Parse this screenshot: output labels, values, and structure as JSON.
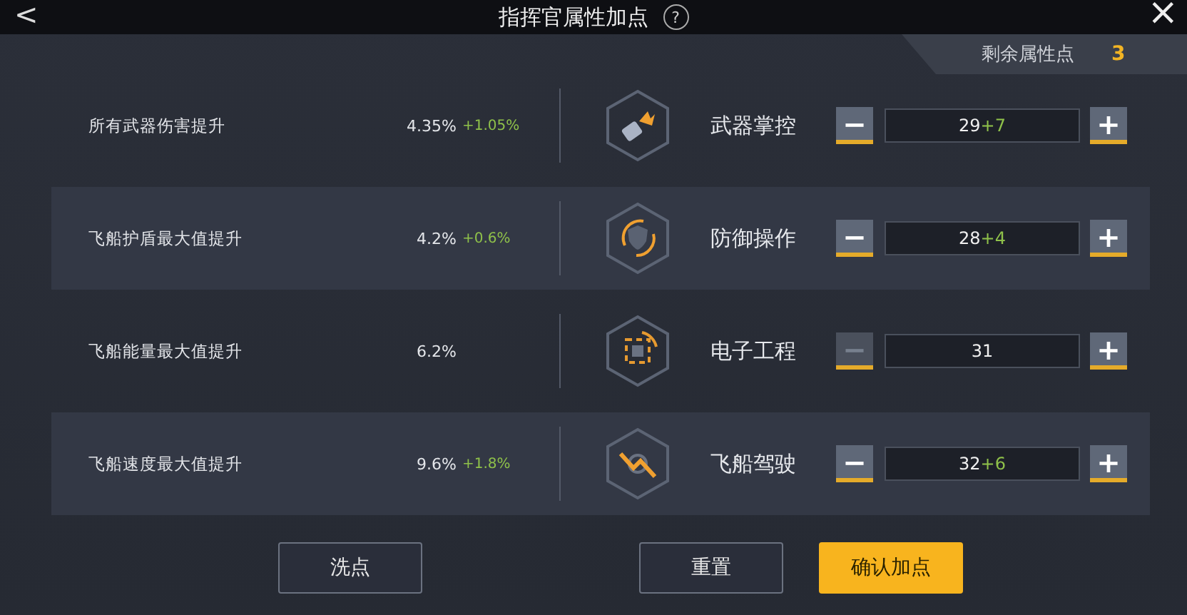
{
  "window": {
    "title": "指挥官属性加点",
    "back": "<",
    "help": "?",
    "close": "×"
  },
  "remaining": {
    "label": "剩余属性点",
    "value": "3"
  },
  "rows": [
    {
      "stat": "所有武器伤害提升",
      "value": "4.35%",
      "bonus": "+1.05%",
      "kind": "weapon",
      "name": "武器掌控",
      "minus": "−",
      "points": "29",
      "added": "+7",
      "plus": "+",
      "minus_disabled": false
    },
    {
      "stat": "飞船护盾最大值提升",
      "value": "4.2%",
      "bonus": "+0.6%",
      "kind": "shield",
      "name": "防御操作",
      "minus": "−",
      "points": "28",
      "added": "+4",
      "plus": "+",
      "minus_disabled": false
    },
    {
      "stat": "飞船能量最大值提升",
      "value": "6.2%",
      "kind": "chip",
      "name": "电子工程",
      "minus": "−",
      "points": "31",
      "plus": "+",
      "minus_disabled": true
    },
    {
      "stat": "飞船速度最大值提升",
      "value": "9.6%",
      "bonus": "+1.8%",
      "kind": "ship",
      "name": "飞船驾驶",
      "minus": "−",
      "points": "32",
      "added": "+6",
      "plus": "+",
      "minus_disabled": false
    }
  ],
  "buttons": [
    {
      "label": "洗点",
      "kind": "outline"
    },
    {
      "label": "重置",
      "kind": "outline"
    },
    {
      "label": "确认加点",
      "kind": "primary"
    }
  ]
}
